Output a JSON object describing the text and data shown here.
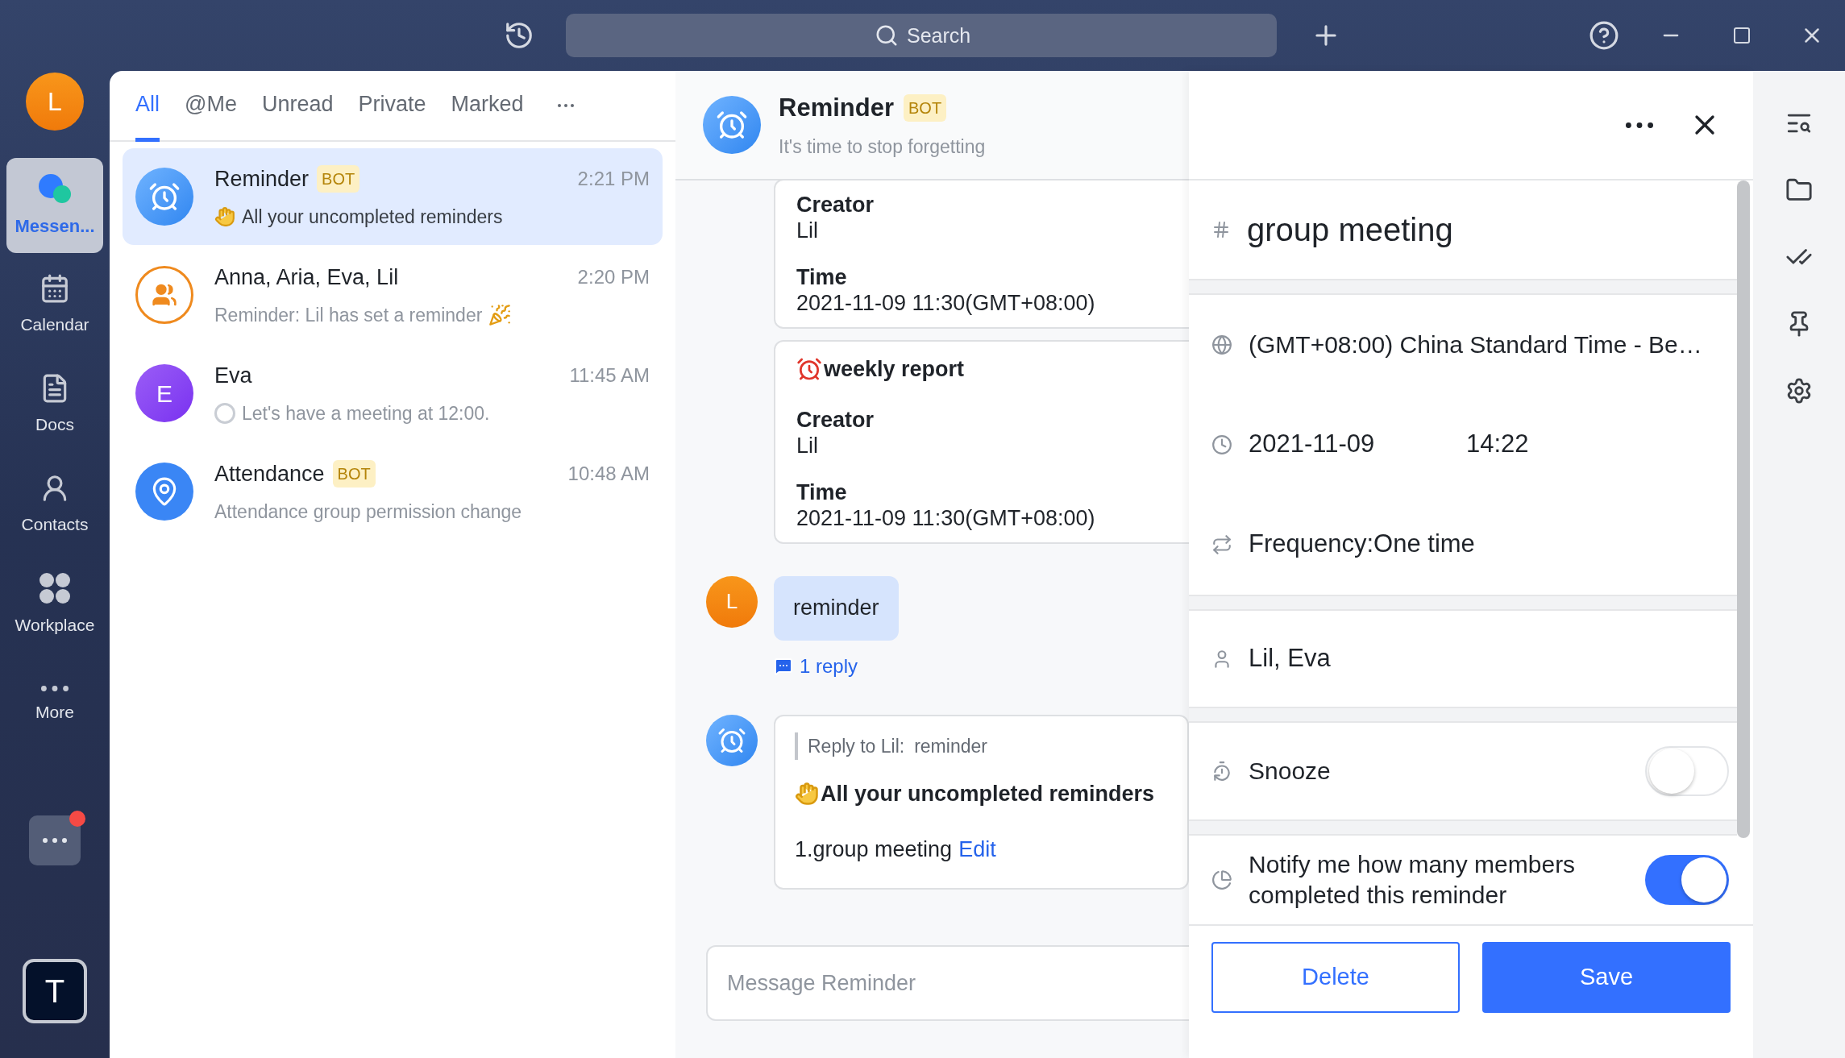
{
  "top_bar": {
    "search": {
      "placeholder": "Search"
    }
  },
  "rail": {
    "avatar": "L",
    "items": [
      {
        "label": "Messen...",
        "kind": "messenger",
        "selected": true
      },
      {
        "label": "Calendar",
        "kind": "calendar",
        "selected": false
      },
      {
        "label": "Docs",
        "kind": "docs",
        "selected": false
      },
      {
        "label": "Contacts",
        "kind": "contacts",
        "selected": false
      },
      {
        "label": "Workplace",
        "kind": "workplace",
        "selected": false
      },
      {
        "label": "More",
        "kind": "more",
        "selected": false
      }
    ],
    "tile": {
      "badge": true
    },
    "app_tile": "T"
  },
  "chat_list": {
    "tabs": [
      {
        "label": "All",
        "selected": true
      },
      {
        "label": "@Me",
        "selected": false
      },
      {
        "label": "Unread",
        "selected": false
      },
      {
        "label": "Private",
        "selected": false
      },
      {
        "label": "Marked",
        "selected": false
      }
    ],
    "chats": [
      {
        "name": "Reminder",
        "badge": "BOT",
        "time": "2:21 PM",
        "preview": "All your uncompleted reminders",
        "avatar": {
          "kind": "alarm"
        },
        "preview_icon": {
          "kind": "clap"
        },
        "selected": true
      },
      {
        "name": "Anna, Aria, Eva, Lil",
        "time": "2:20 PM",
        "preview": "Reminder: Lil has set a reminder",
        "avatar": {
          "kind": "group"
        },
        "preview_icon": {
          "kind": "party"
        },
        "selected": false
      },
      {
        "name": "Eva",
        "letter": "E",
        "time": "11:45 AM",
        "preview": "Let's have a meeting at 12:00.",
        "avatar": {
          "kind": "letter"
        },
        "preview_icon": {
          "kind": "circle"
        },
        "selected": false
      },
      {
        "name": "Attendance",
        "badge": "BOT",
        "time": "10:48 AM",
        "preview": "Attendance group permission change",
        "avatar": {
          "kind": "location"
        },
        "selected": false
      }
    ]
  },
  "chat": {
    "title": "Reminder",
    "badge": "BOT",
    "subtitle": "It's time to stop forgetting",
    "messages": [
      {
        "kind": "card",
        "fields": [
          {
            "label": "Creator",
            "value": "Lil"
          },
          {
            "label": "Time",
            "value": "2021-11-09 11:30(GMT+08:00)"
          }
        ]
      },
      {
        "kind": "card",
        "heading": "weekly report",
        "fields": [
          {
            "label": "Creator",
            "value": "Lil"
          },
          {
            "label": "Time",
            "value": "2021-11-09 11:30(GMT+08:00)"
          }
        ]
      },
      {
        "kind": "bubble",
        "avatar": "L",
        "text": "reminder",
        "replies": "1 reply"
      },
      {
        "kind": "reply_card",
        "quote_label": "Reply to Lil:",
        "quote_text": "reminder",
        "heading": "All your uncompleted reminders",
        "line": "1.group meeting",
        "link": "Edit"
      }
    ],
    "composer": {
      "placeholder": "Message Reminder"
    }
  },
  "detail": {
    "title": "group meeting",
    "timezone": "(GMT+08:00) China Standard Time - Be…",
    "date": "2021-11-09",
    "time": "14:22",
    "frequency": "Frequency:One time",
    "members": "Lil, Eva",
    "toggles": [
      {
        "kind": "snooze",
        "label": "Snooze",
        "on": false
      },
      {
        "kind": "notify",
        "label": "Notify me how many members completed this reminder",
        "on": true
      }
    ],
    "delete": "Delete",
    "save": "Save"
  }
}
